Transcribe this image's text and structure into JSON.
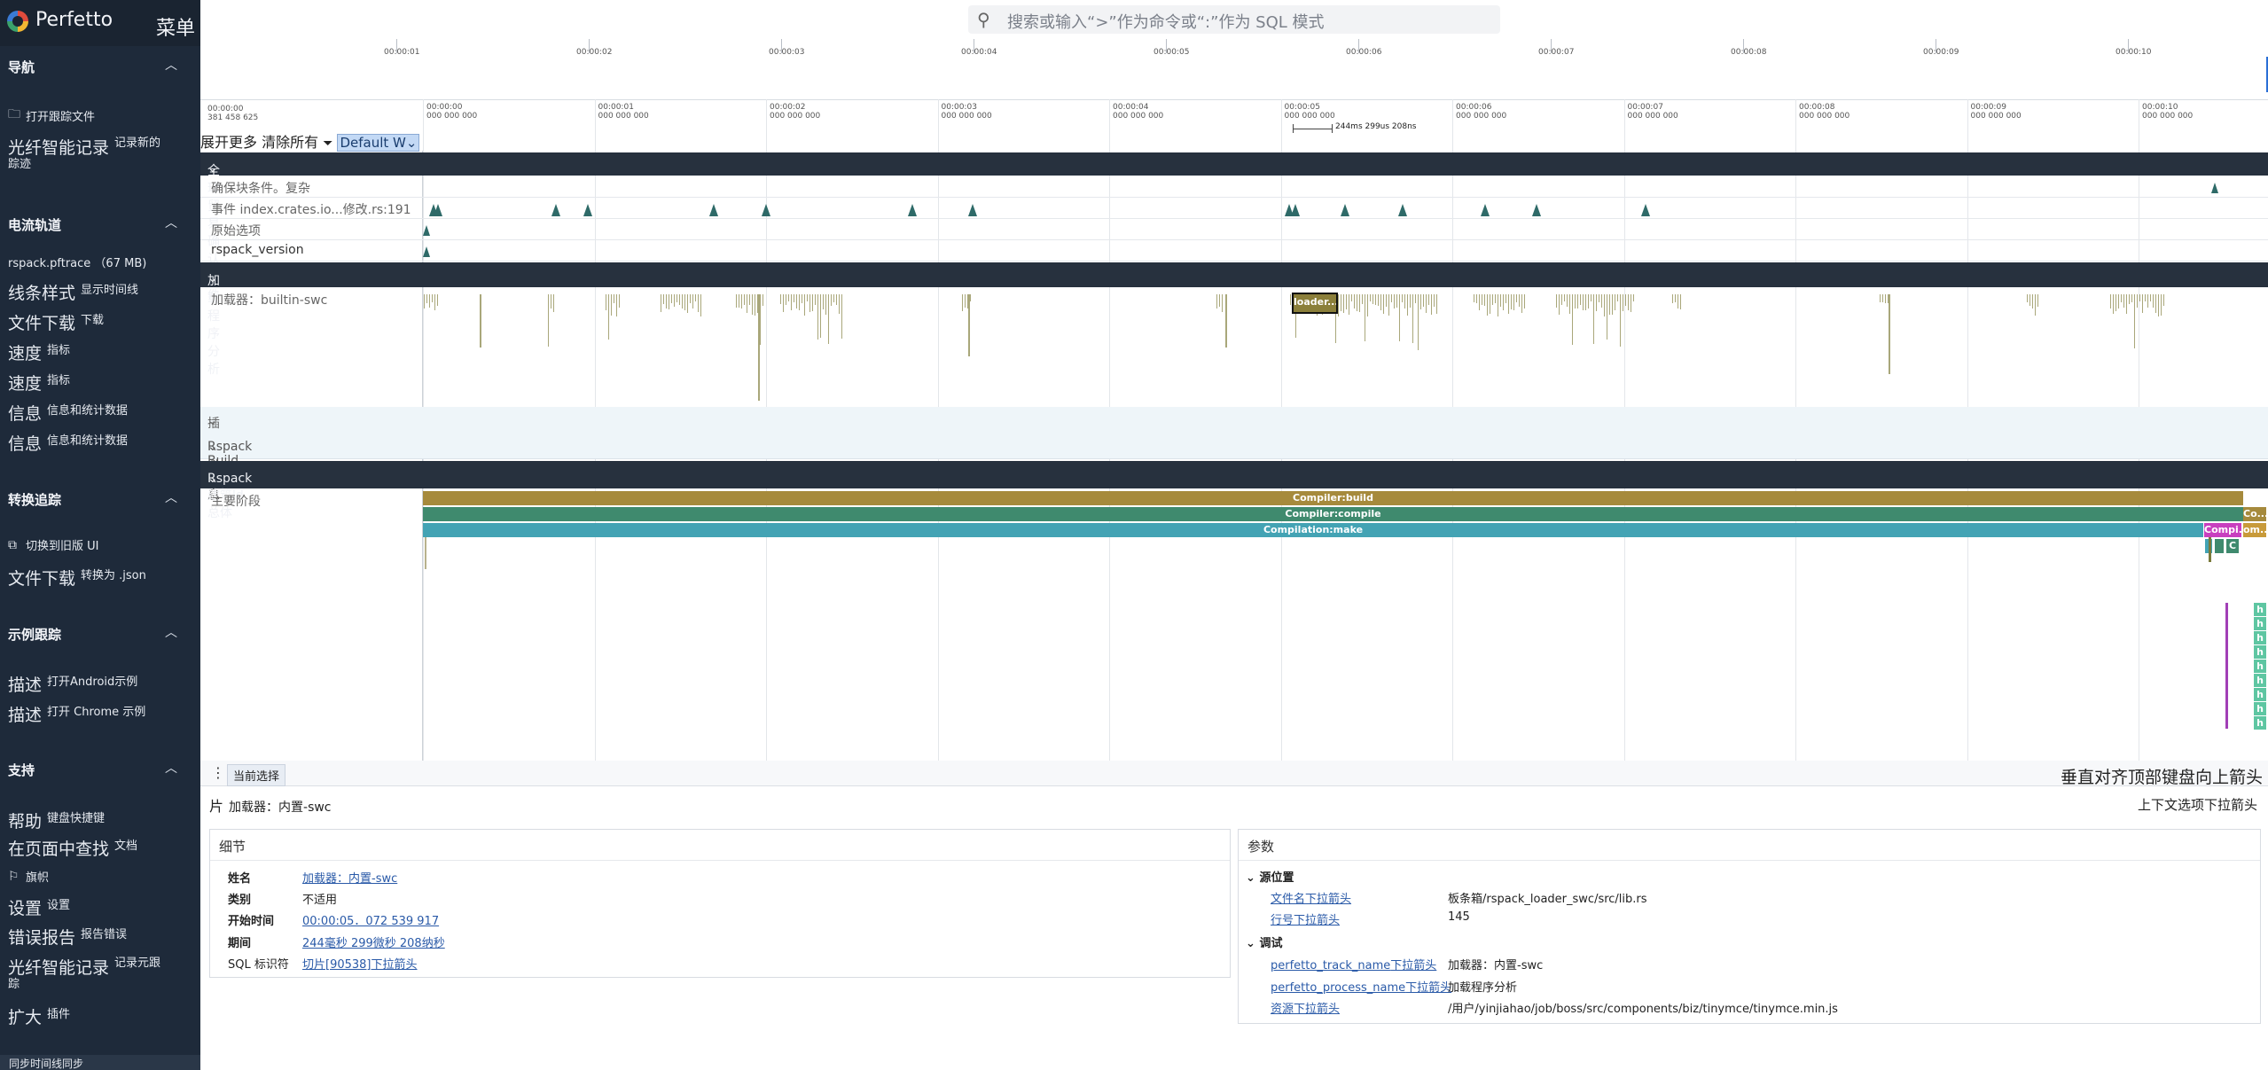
{
  "brand": {
    "title": "Perfetto",
    "menu": "菜单"
  },
  "search": {
    "placeholder": "搜索或输入“>”作为命令或“:”作为 SQL 模式"
  },
  "sidebar": {
    "sections": [
      {
        "title": "导航",
        "items": [
          {
            "icon": "folder-icon",
            "text": "打开跟踪文件"
          },
          {
            "big": "光纤智能记录",
            "small": "记录新的",
            "wrap": "踪迹"
          }
        ]
      },
      {
        "title": "电流轨道",
        "items": [
          {
            "text": "rspack.pftrace （67 MB)"
          },
          {
            "big": "线条样式",
            "small": "显示时间线"
          },
          {
            "big": "文件下载",
            "small": "下载"
          },
          {
            "big": "速度",
            "small": "指标"
          },
          {
            "big": "速度",
            "small": "指标"
          },
          {
            "big": "信息",
            "small": "信息和统计数据"
          },
          {
            "big": "信息",
            "small": "信息和统计数据"
          }
        ]
      },
      {
        "title": "转换追踪",
        "items": [
          {
            "icon": "copy-icon",
            "text": "切换到旧版 UI"
          },
          {
            "big": "文件下载",
            "small": "转换为 .json"
          }
        ]
      },
      {
        "title": "示例跟踪",
        "items": [
          {
            "big": "描述",
            "small": "打开Android示例"
          },
          {
            "big": "描述",
            "small": "打开 Chrome 示例"
          }
        ]
      },
      {
        "title": "支持",
        "items": [
          {
            "big": "帮助",
            "small": "键盘快捷键"
          },
          {
            "big": "在页面中查找",
            "small": "文档"
          },
          {
            "icon": "flag-icon",
            "text": "旗帜"
          },
          {
            "big": "设置",
            "small": "设置"
          },
          {
            "big": "错误报告",
            "small": "报告错误"
          },
          {
            "big": "光纤智能记录",
            "small": "记录元跟",
            "wrap": "踪"
          },
          {
            "big": "扩大",
            "small": "插件"
          }
        ]
      }
    ],
    "bottom_tab": "同步时间线同步"
  },
  "overview": {
    "ticks": [
      "00:00:01",
      "00:00:02",
      "00:00:03",
      "00:00:04",
      "00:00:05",
      "00:00:06",
      "00:00:07",
      "00:00:08",
      "00:00:09",
      "00:00:10"
    ]
  },
  "timeaxis": {
    "origin": "00:00:00",
    "origin_sub": "381 458 625",
    "ticks": [
      "00:00:00",
      "00:00:01",
      "00:00:02",
      "00:00:03",
      "00:00:04",
      "00:00:05",
      "00:00:06",
      "00:00:07",
      "00:00:08",
      "00:00:09",
      "00:00:10"
    ],
    "tick_sub": "000 000 000",
    "span_label": "244ms 299us 208ns"
  },
  "toolbar": {
    "actions": "展开更多 清除所有",
    "workspace": "Default W"
  },
  "groups": {
    "g1": "全球贸易确认事件",
    "g1_tracks": [
      "确保块条件。复杂",
      "事件 index.crates.io...修改.rs:191",
      "原始选项",
      "rspack_version"
    ],
    "g2": "加载程序分析",
    "g2_track": "加载器：builtin-swc",
    "g2_slice": "loader...",
    "g3": "插件分析",
    "g4": "Rspack Build 详细信息",
    "g5": "Rspack 建筑ld 总体",
    "g5_track": "主要阶段",
    "slices": {
      "build": "Compiler:build",
      "compile": "Compiler:compile",
      "make": "Compilation:make",
      "co": "Co...",
      "compi": "Compi...",
      "om": "om...",
      "c": "C",
      "h": "h"
    }
  },
  "panel": {
    "tab": "当前选择",
    "right_text": "垂直对齐顶部键盘向上箭头",
    "slice_label": "片",
    "slice_name": "加载器：内置-swc",
    "ctx": "上下文选项",
    "ctx_suffix": "下拉箭头",
    "details": {
      "title": "细节",
      "rows": [
        {
          "k": "姓名",
          "v": "加载器：内置-swc",
          "link": true
        },
        {
          "k": "类别",
          "v": "不适用",
          "link": false
        },
        {
          "k": "开始时间",
          "v": "00:00:05．072 539 917",
          "link": true
        },
        {
          "k": "期间",
          "v": "244毫秒 299微秒 208纳秒",
          "link": true
        },
        {
          "k": "SQL 标识符",
          "v": "切片[90538]下拉箭头",
          "link": true
        }
      ]
    },
    "args": {
      "title": "参数",
      "src_head": "源位置",
      "file_k": "文件名",
      "file_v": "板条箱/rspack_loader_swc/src/lib.rs",
      "line_k": "行号",
      "line_v": "145",
      "debug_head": "调试",
      "track_k": "perfetto_track_name",
      "track_v": "加载器：内置-swc",
      "proc_k": "perfetto_process_name",
      "proc_v": "加载程序分析",
      "res_k": "资源",
      "res_v": "/用户/yinjiahao/job/boss/src/components/biz/tinymce/tinymce.min.js",
      "drop": "下拉箭头"
    }
  },
  "colors": {
    "sidebar_bg": "#1e2a3a",
    "group_bg": "#27313e",
    "build": "#a68a3c",
    "compile": "#3f8a6e",
    "make": "#43a3b4",
    "compi": "#c83fbf",
    "h": "#5ec6a2",
    "loader_ticks": "#a9a77a",
    "event_marks": "#2e6a68"
  }
}
